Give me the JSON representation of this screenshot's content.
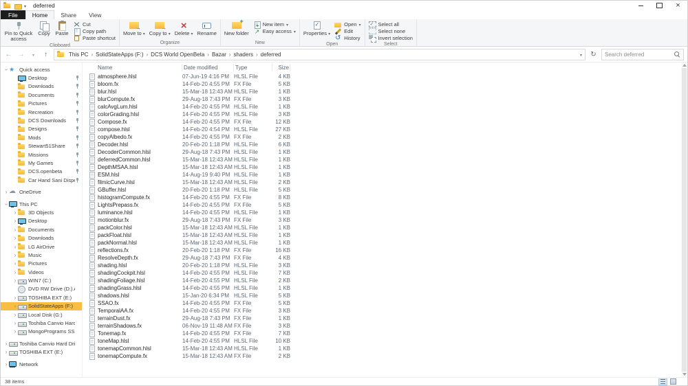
{
  "colors": {
    "sidebar_selection": "#f7bd45",
    "file_tab_bg": "#1d1d1d",
    "ribbon_bg": "#f5f6f7",
    "folder_icon": "#f6b73c",
    "secondary_text": "#5d6772"
  },
  "window": {
    "title": "deferred"
  },
  "ribbon_tabs": {
    "file": "File",
    "home": "Home",
    "share": "Share",
    "view": "View"
  },
  "ribbon": {
    "clipboard": {
      "label": "Clipboard",
      "pin": "Pin to Quick access",
      "copy": "Copy",
      "paste": "Paste",
      "cut": "Cut",
      "copy_path": "Copy path",
      "paste_shortcut": "Paste shortcut"
    },
    "organize": {
      "label": "Organize",
      "move_to": "Move to",
      "copy_to": "Copy to",
      "delete": "Delete",
      "rename": "Rename"
    },
    "new": {
      "label": "New",
      "new_folder": "New folder",
      "new_item": "New item",
      "easy_access": "Easy access"
    },
    "open": {
      "label": "Open",
      "properties": "Properties",
      "open": "Open",
      "edit": "Edit",
      "history": "History"
    },
    "select": {
      "label": "Select",
      "select_all": "Select all",
      "select_none": "Select none",
      "invert_selection": "Invert selection"
    }
  },
  "address": {
    "breadcrumbs": [
      "This PC",
      "SolidStateApps (F:)",
      "DCS World OpenBeta",
      "Bazar",
      "shaders",
      "deferred"
    ],
    "search_placeholder": "Search deferred"
  },
  "columns": {
    "name": "Name",
    "date_modified": "Date modified",
    "type": "Type",
    "size": "Size"
  },
  "sidebar": {
    "items": [
      {
        "label": "Quick access",
        "icon": "star",
        "level": 0,
        "expander": "down"
      },
      {
        "label": "Desktop",
        "icon": "desktop",
        "level": 1,
        "pinned": true
      },
      {
        "label": "Downloads",
        "icon": "downloads",
        "level": 1,
        "pinned": true
      },
      {
        "label": "Documents",
        "icon": "documents",
        "level": 1,
        "pinned": true
      },
      {
        "label": "Pictures",
        "icon": "pictures",
        "level": 1,
        "pinned": true
      },
      {
        "label": "Recreation",
        "icon": "folder",
        "level": 1,
        "pinned": true
      },
      {
        "label": "DCS Downloads",
        "icon": "folder",
        "level": 1,
        "pinned": true
      },
      {
        "label": "Designs",
        "icon": "folder",
        "level": 1,
        "pinned": true
      },
      {
        "label": "Mods",
        "icon": "folder",
        "level": 1,
        "pinned": true
      },
      {
        "label": "Stewart51Share",
        "icon": "folder",
        "level": 1,
        "pinned": true
      },
      {
        "label": "Missions",
        "icon": "folder",
        "level": 1,
        "pinned": true
      },
      {
        "label": "My Games",
        "icon": "folder",
        "level": 1,
        "pinned": true
      },
      {
        "label": "DCS.openbeta",
        "icon": "folder",
        "level": 1,
        "pinned": true
      },
      {
        "label": "Car Hand Sani Dispenser",
        "icon": "folder",
        "level": 1,
        "pinned": true
      },
      {
        "label": "OneDrive",
        "icon": "cloud",
        "level": 0,
        "expander": "right",
        "gap": true
      },
      {
        "label": "This PC",
        "icon": "pc",
        "level": 0,
        "expander": "down",
        "gap": true
      },
      {
        "label": "3D Objects",
        "icon": "folder3d",
        "level": 1,
        "expander": "right"
      },
      {
        "label": "Desktop",
        "icon": "desktop",
        "level": 1,
        "expander": "right"
      },
      {
        "label": "Documents",
        "icon": "documents",
        "level": 1,
        "expander": "right"
      },
      {
        "label": "Downloads",
        "icon": "downloads",
        "level": 1,
        "expander": "right"
      },
      {
        "label": "LG AirDrive",
        "icon": "folder",
        "level": 1,
        "expander": "right"
      },
      {
        "label": "Music",
        "icon": "music",
        "level": 1,
        "expander": "right"
      },
      {
        "label": "Pictures",
        "icon": "pictures",
        "level": 1,
        "expander": "right"
      },
      {
        "label": "Videos",
        "icon": "videos",
        "level": 1,
        "expander": "right"
      },
      {
        "label": "WIN7 (C:)",
        "icon": "drive-os",
        "level": 1,
        "expander": "right"
      },
      {
        "label": "DVD RW Drive (D:) Audio CD",
        "icon": "drive-cd",
        "level": 1
      },
      {
        "label": "TOSHIBA EXT (E:)",
        "icon": "drive",
        "level": 1,
        "expander": "right"
      },
      {
        "label": "SolidStateApps (F:)",
        "icon": "drive",
        "level": 1,
        "expander": "right",
        "selected": true
      },
      {
        "label": "Local Disk (G:)",
        "icon": "drive",
        "level": 1,
        "expander": "right"
      },
      {
        "label": "Toshiba Canvio Hard Drive (H:)",
        "icon": "drive",
        "level": 1,
        "expander": "right"
      },
      {
        "label": "MongoPrograms SSD (Z:)",
        "icon": "drive",
        "level": 1,
        "expander": "right"
      },
      {
        "label": "Toshiba Canvio Hard Drive (H:)",
        "icon": "drive",
        "level": 0,
        "expander": "right",
        "gap": true
      },
      {
        "label": "TOSHIBA EXT (E:)",
        "icon": "drive",
        "level": 0,
        "expander": "right"
      },
      {
        "label": "Network",
        "icon": "network",
        "level": 0,
        "expander": "right",
        "gap": true
      }
    ]
  },
  "files": [
    {
      "name": "atmosphere.hlsl",
      "date": "07-Jun-19 4:16 PM",
      "type": "HLSL File",
      "size": "4 KB"
    },
    {
      "name": "bloom.fx",
      "date": "14-Feb-20 4:55 PM",
      "type": "FX File",
      "size": "5 KB"
    },
    {
      "name": "blur.hlsl",
      "date": "15-Mar-18 12:43 AM",
      "type": "HLSL File",
      "size": "1 KB"
    },
    {
      "name": "blurCompute.fx",
      "date": "29-Aug-18 7:43 PM",
      "type": "FX File",
      "size": "3 KB"
    },
    {
      "name": "calcAvgLum.hlsl",
      "date": "14-Feb-20 4:55 PM",
      "type": "HLSL File",
      "size": "1 KB"
    },
    {
      "name": "colorGrading.hlsl",
      "date": "14-Feb-20 4:55 PM",
      "type": "HLSL File",
      "size": "3 KB"
    },
    {
      "name": "Compose.fx",
      "date": "14-Feb-20 4:55 PM",
      "type": "FX File",
      "size": "12 KB"
    },
    {
      "name": "compose.hlsl",
      "date": "14-Feb-20 4:54 PM",
      "type": "HLSL File",
      "size": "27 KB"
    },
    {
      "name": "copyAlbedo.fx",
      "date": "14-Feb-20 4:55 PM",
      "type": "FX File",
      "size": "2 KB"
    },
    {
      "name": "Decoder.hlsl",
      "date": "20-Feb-20 1:18 PM",
      "type": "HLSL File",
      "size": "6 KB"
    },
    {
      "name": "DecoderCommon.hlsl",
      "date": "29-Aug-18 7:43 PM",
      "type": "HLSL File",
      "size": "1 KB"
    },
    {
      "name": "deferredCommon.hlsl",
      "date": "15-Mar-18 12:43 AM",
      "type": "HLSL File",
      "size": "1 KB"
    },
    {
      "name": "DepthMSAA.hlsl",
      "date": "15-Mar-18 12:43 AM",
      "type": "HLSL File",
      "size": "1 KB"
    },
    {
      "name": "ESM.hlsl",
      "date": "14-Aug-19 9:40 PM",
      "type": "HLSL File",
      "size": "1 KB"
    },
    {
      "name": "filmicCurve.hlsl",
      "date": "15-Mar-18 12:43 AM",
      "type": "HLSL File",
      "size": "2 KB"
    },
    {
      "name": "GBuffer.hlsl",
      "date": "20-Feb-20 1:18 PM",
      "type": "HLSL File",
      "size": "5 KB"
    },
    {
      "name": "histogramCompute.fx",
      "date": "14-Feb-20 4:55 PM",
      "type": "FX File",
      "size": "8 KB"
    },
    {
      "name": "LightsPrepass.fx",
      "date": "14-Feb-20 4:55 PM",
      "type": "FX File",
      "size": "5 KB"
    },
    {
      "name": "luminance.hlsl",
      "date": "14-Feb-20 4:55 PM",
      "type": "HLSL File",
      "size": "1 KB"
    },
    {
      "name": "motionblur.fx",
      "date": "29-Aug-18 7:43 PM",
      "type": "FX File",
      "size": "3 KB"
    },
    {
      "name": "packColor.hlsl",
      "date": "15-Mar-18 12:43 AM",
      "type": "HLSL File",
      "size": "1 KB"
    },
    {
      "name": "packFloat.hlsl",
      "date": "15-Mar-18 12:43 AM",
      "type": "HLSL File",
      "size": "1 KB"
    },
    {
      "name": "packNormal.hlsl",
      "date": "15-Mar-18 12:43 AM",
      "type": "HLSL File",
      "size": "1 KB"
    },
    {
      "name": "reflections.fx",
      "date": "20-Feb-20 1:18 PM",
      "type": "FX File",
      "size": "16 KB"
    },
    {
      "name": "ResolveDepth.fx",
      "date": "29-Aug-18 7:43 PM",
      "type": "FX File",
      "size": "4 KB"
    },
    {
      "name": "shading.hlsl",
      "date": "20-Feb-20 1:18 PM",
      "type": "HLSL File",
      "size": "3 KB"
    },
    {
      "name": "shadingCockpit.hlsl",
      "date": "14-Feb-20 4:55 PM",
      "type": "HLSL File",
      "size": "7 KB"
    },
    {
      "name": "shadingFoliage.hlsl",
      "date": "14-Feb-20 4:55 PM",
      "type": "HLSL File",
      "size": "2 KB"
    },
    {
      "name": "shadingGrass.hlsl",
      "date": "14-Feb-20 4:55 PM",
      "type": "HLSL File",
      "size": "1 KB"
    },
    {
      "name": "shadows.hlsl",
      "date": "15-Jan-20 6:34 PM",
      "type": "HLSL File",
      "size": "5 KB"
    },
    {
      "name": "SSAO.fx",
      "date": "14-Feb-20 4:55 PM",
      "type": "FX File",
      "size": "5 KB"
    },
    {
      "name": "TemporalAA.fx",
      "date": "14-Feb-20 4:55 PM",
      "type": "FX File",
      "size": "3 KB"
    },
    {
      "name": "terrainDust.fx",
      "date": "29-Aug-18 7:43 PM",
      "type": "FX File",
      "size": "1 KB"
    },
    {
      "name": "terrainShadows.fx",
      "date": "06-Nov-19 11:48 AM",
      "type": "FX File",
      "size": "3 KB"
    },
    {
      "name": "Tonemap.fx",
      "date": "14-Feb-20 4:55 PM",
      "type": "FX File",
      "size": "7 KB"
    },
    {
      "name": "toneMap.hlsl",
      "date": "14-Feb-20 4:55 PM",
      "type": "HLSL File",
      "size": "10 KB"
    },
    {
      "name": "tonemapCommon.hlsl",
      "date": "15-Mar-18 12:43 AM",
      "type": "HLSL File",
      "size": "1 KB"
    },
    {
      "name": "tonemapCompute.fx",
      "date": "15-Mar-18 12:43 AM",
      "type": "FX File",
      "size": "2 KB"
    }
  ],
  "status": {
    "items_count": "38 items"
  }
}
